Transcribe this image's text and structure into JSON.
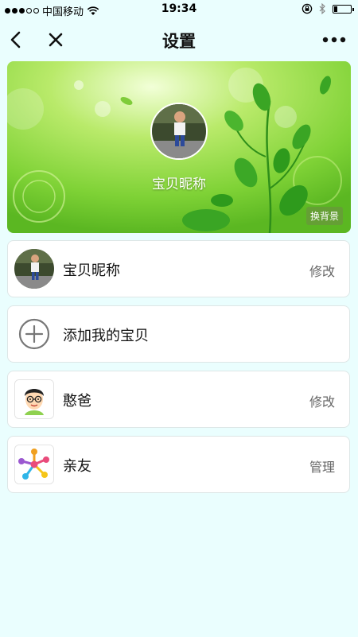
{
  "status_bar": {
    "carrier": "中国移动",
    "time": "19:34"
  },
  "nav": {
    "title": "设置"
  },
  "banner": {
    "baby_name": "宝贝昵称",
    "change_bg_label": "换背景"
  },
  "list": [
    {
      "label": "宝贝昵称",
      "action": "修改",
      "icon": "baby-avatar"
    },
    {
      "label": "添加我的宝贝",
      "action": "",
      "icon": "plus-circle-icon"
    },
    {
      "label": "憨爸",
      "action": "修改",
      "icon": "dad-avatar"
    },
    {
      "label": "亲友",
      "action": "管理",
      "icon": "family-network-icon"
    }
  ],
  "colors": {
    "page_bg": "#eafefe",
    "banner_green": "#8bd63a",
    "action_gray": "#666666"
  }
}
